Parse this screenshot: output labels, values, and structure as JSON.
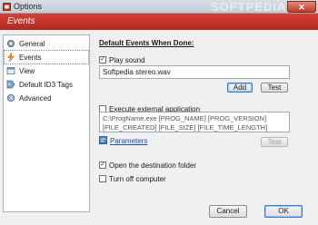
{
  "window": {
    "title": "Options",
    "watermark": "SOFTPEDIA",
    "close_glyph": "✕"
  },
  "header": {
    "title": "Events"
  },
  "nav": {
    "items": [
      {
        "label": "General",
        "icon": "gear-icon"
      },
      {
        "label": "Events",
        "icon": "lightning-icon",
        "selected": true
      },
      {
        "label": "View",
        "icon": "view-icon"
      },
      {
        "label": "Default ID3 Tags",
        "icon": "tag-icon"
      },
      {
        "label": "Advanced",
        "icon": "advanced-icon"
      }
    ]
  },
  "main": {
    "section_title": "Default Events When Done:",
    "play_sound": {
      "label": "Play sound",
      "checked": true,
      "checkmark": "✓",
      "value": "Softpedia stereo.wav",
      "add_label": "Add",
      "test_label": "Test"
    },
    "execute_app": {
      "label": "Execute external application",
      "checked": false,
      "command_lines": [
        "C:\\ProgName.exe [PROG_NAME] [PROG_VERSION]",
        "[FILE_CREATED] [FILE_SIZE] [FILE_TIME_LENGTH]"
      ],
      "parameters_label": "Parameters",
      "test_label": "Test"
    },
    "open_folder": {
      "label": "Open the destination folder",
      "checked": true,
      "checkmark": "✓"
    },
    "turn_off": {
      "label": "Turn off computer",
      "checked": false
    }
  },
  "footer": {
    "cancel_label": "Cancel",
    "ok_label": "OK"
  }
}
